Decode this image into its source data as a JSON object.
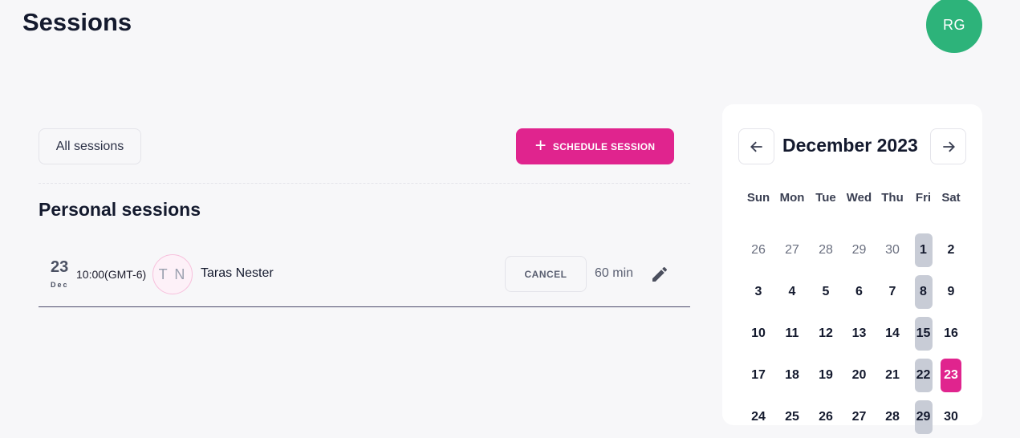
{
  "header": {
    "title": "Sessions",
    "avatar_initials": "RG"
  },
  "toolbar": {
    "filter_label": "All sessions",
    "schedule_label": "SCHEDULE SESSION"
  },
  "section": {
    "title": "Personal sessions"
  },
  "session": {
    "day": "23",
    "month": "Dec",
    "time": "10:00(GMT-6)",
    "initials": "T N",
    "client_name": "Taras Nester",
    "cancel_label": "CANCEL",
    "duration": "60 min"
  },
  "calendar": {
    "month_label": "December 2023",
    "weekdays": [
      "Sun",
      "Mon",
      "Tue",
      "Wed",
      "Thu",
      "Fri",
      "Sat"
    ],
    "weeks": [
      [
        {
          "d": "26",
          "muted": true
        },
        {
          "d": "27",
          "muted": true
        },
        {
          "d": "28",
          "muted": true
        },
        {
          "d": "29",
          "muted": true
        },
        {
          "d": "30",
          "muted": true
        },
        {
          "d": "1",
          "hl": true
        },
        {
          "d": "2"
        }
      ],
      [
        {
          "d": "3"
        },
        {
          "d": "4"
        },
        {
          "d": "5"
        },
        {
          "d": "6"
        },
        {
          "d": "7"
        },
        {
          "d": "8",
          "hl": true
        },
        {
          "d": "9"
        }
      ],
      [
        {
          "d": "10"
        },
        {
          "d": "11"
        },
        {
          "d": "12"
        },
        {
          "d": "13"
        },
        {
          "d": "14"
        },
        {
          "d": "15",
          "hl": true
        },
        {
          "d": "16"
        }
      ],
      [
        {
          "d": "17"
        },
        {
          "d": "18"
        },
        {
          "d": "19"
        },
        {
          "d": "20"
        },
        {
          "d": "21"
        },
        {
          "d": "22",
          "hl": true
        },
        {
          "d": "23",
          "sel": true
        }
      ],
      [
        {
          "d": "24"
        },
        {
          "d": "25"
        },
        {
          "d": "26"
        },
        {
          "d": "27"
        },
        {
          "d": "28"
        },
        {
          "d": "29",
          "hl": true
        },
        {
          "d": "30"
        }
      ]
    ]
  },
  "colors": {
    "accent": "#e0248e",
    "avatar": "#2db37a",
    "highlight": "#c8ccd6"
  },
  "icons": {
    "plus": "plus-icon",
    "prev": "arrow-left-icon",
    "next": "arrow-right-icon",
    "edit": "pencil-icon"
  }
}
